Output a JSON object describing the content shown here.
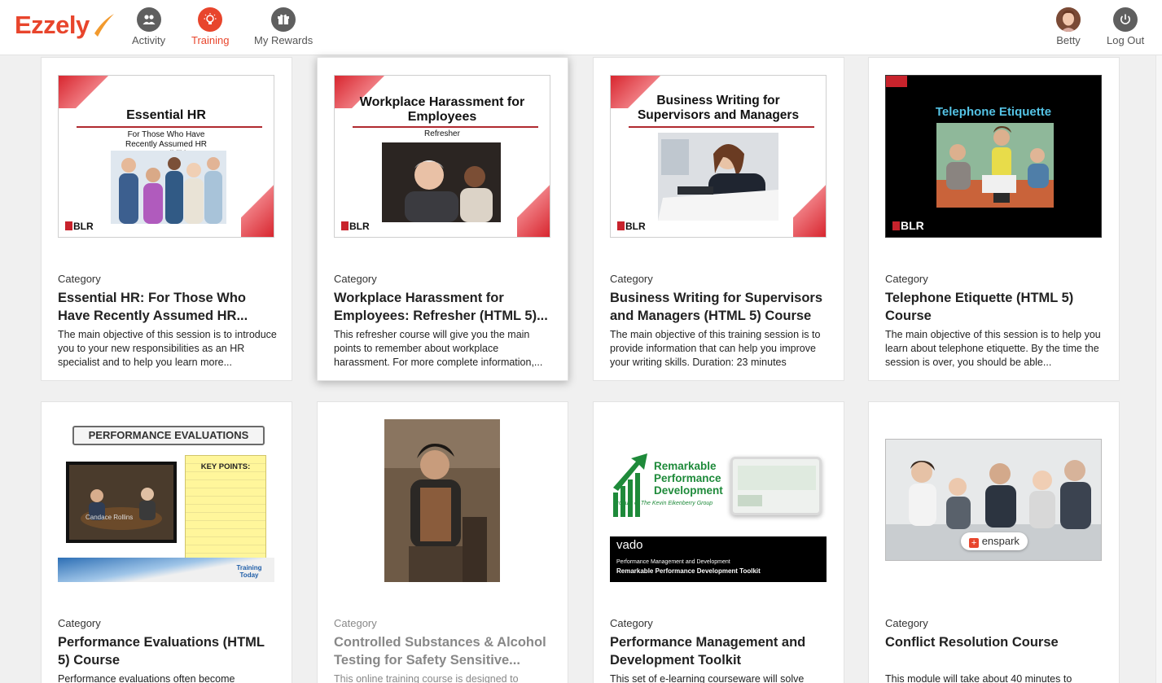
{
  "app": {
    "logo": "Ezzely",
    "nav": [
      {
        "label": "Activity",
        "icon": "people-icon",
        "active": false
      },
      {
        "label": "Training",
        "icon": "lightbulb-icon",
        "active": true
      },
      {
        "label": "My Rewards",
        "icon": "gift-icon",
        "active": false
      }
    ],
    "user": {
      "label": "Betty",
      "icon": "avatar"
    },
    "logout": {
      "label": "Log Out",
      "icon": "power-icon"
    }
  },
  "colors": {
    "accent": "#e8452c",
    "nav_icon": "#5f5f5f"
  },
  "courses": [
    {
      "category": "Category",
      "title": "Essential HR: For Those Who Have Recently Assumed HR...",
      "description": "The main objective of this session is to introduce you to your new responsibilities as an HR specialist and to help you learn more...",
      "thumb": {
        "title": "Essential HR",
        "subtitle": "For Those Who Have Recently Assumed HR Responsibilities",
        "brand": "BLR"
      }
    },
    {
      "category": "Category",
      "title": "Workplace Harassment for Employees: Refresher (HTML 5)...",
      "description": "This refresher course will give you the main points to remember about workplace harassment. For more complete information,...",
      "thumb": {
        "title": "Workplace Harassment for Employees",
        "subtitle": "Refresher",
        "brand": "BLR"
      }
    },
    {
      "category": "Category",
      "title": "Business Writing for Supervisors and Managers (HTML 5) Course",
      "description": "The main objective of this training session is to provide information that can help you improve your writing skills. Duration: 23 minutes",
      "thumb": {
        "title": "Business Writing for Supervisors and Managers",
        "brand": "BLR"
      }
    },
    {
      "category": "Category",
      "title": "Telephone Etiquette (HTML 5) Course",
      "description": "The main objective of this session is to help you learn about telephone etiquette. By the time the session is over, you should be able...",
      "thumb": {
        "title": "Telephone Etiquette",
        "brand": "BLR"
      }
    },
    {
      "category": "Category",
      "title": "Performance Evaluations (HTML 5) Course",
      "description": "Performance evaluations often become",
      "thumb": {
        "title": "PERFORMANCE EVALUATIONS",
        "subtitle": "KEY POINTS:",
        "caption": "Candace Rollins",
        "brand": "Training Today"
      }
    },
    {
      "category": "Category",
      "title": "Controlled Substances & Alcohol Testing for Safety Sensitive...",
      "description": "This online training course is designed to",
      "thumb": {}
    },
    {
      "category": "Category",
      "title": "Performance Management and Development Toolkit",
      "description": "This set of e-learning courseware will solve",
      "thumb": {
        "title": "Remarkable Performance Development",
        "byline": "Product of The Kevin Eikenberry Group",
        "brand": "vado",
        "line1": "Performance Management and Development",
        "line2": "Remarkable Performance Development Toolkit"
      }
    },
    {
      "category": "Category",
      "title": "Conflict Resolution Course",
      "description": "This module will take about 40 minutes to",
      "thumb": {
        "brand": "enspark"
      }
    }
  ]
}
